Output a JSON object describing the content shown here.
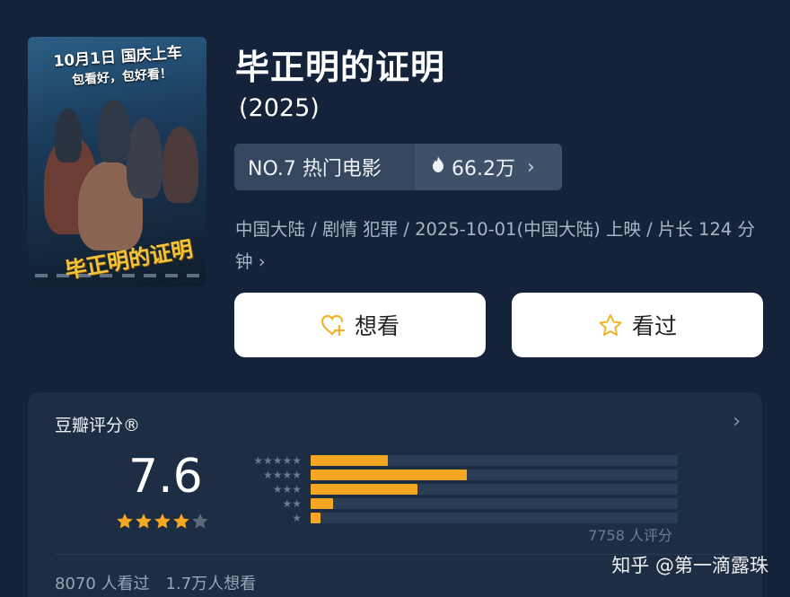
{
  "poster": {
    "tagline_top": "10月1日 国庆上车",
    "tagline_sub": "包看好，包好看！",
    "title_art": "毕正明的证明"
  },
  "movie": {
    "title": "毕正明的证明",
    "year": "(2025)"
  },
  "rank": {
    "label": "NO.7 热门电影",
    "heat_icon": "flame-icon",
    "heat_value": "66.2万"
  },
  "meta": {
    "line": "中国大陆 / 剧情 犯罪 / 2025-10-01(中国大陆) 上映 / 片长 124 分钟"
  },
  "actions": {
    "want_label": "想看",
    "seen_label": "看过"
  },
  "rating": {
    "header": "豆瓣评分®",
    "score": "7.6",
    "avg_stars": 4,
    "star_color": "#f5a623",
    "distribution": [
      {
        "stars": 5,
        "fraction": 0.21
      },
      {
        "stars": 4,
        "fraction": 0.425
      },
      {
        "stars": 3,
        "fraction": 0.29
      },
      {
        "stars": 2,
        "fraction": 0.06
      },
      {
        "stars": 1,
        "fraction": 0.027
      }
    ],
    "count": "7758 人评分",
    "seen_count": "8070 人看过",
    "want_count": "1.7万人想看"
  },
  "watermark": "知乎 @第一滴露珠",
  "colors": {
    "background": "#14233a",
    "card": "#1c2d44",
    "accent": "#f5a623"
  }
}
